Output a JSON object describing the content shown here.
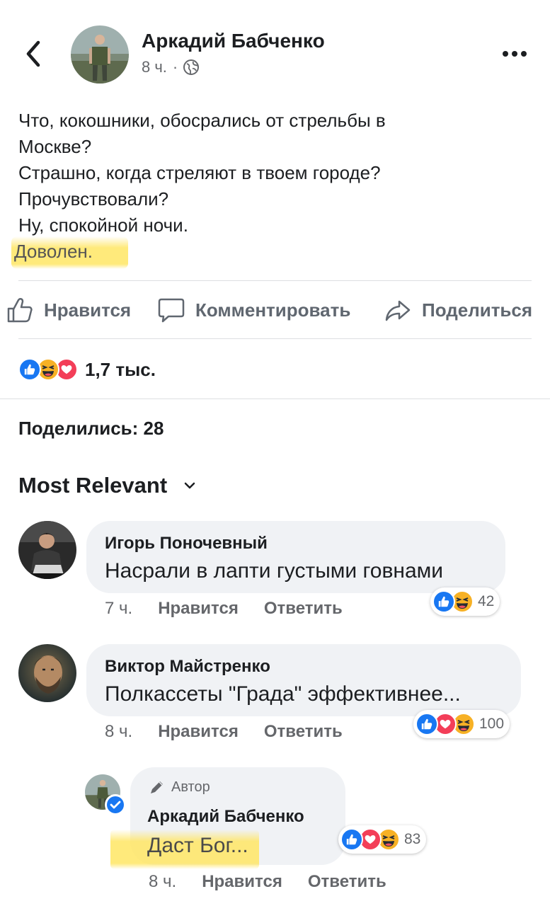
{
  "header": {
    "author_name": "Аркадий Бабченко",
    "time": "8 ч.",
    "separator": "·",
    "privacy_icon": "globe-icon",
    "back_icon": "chevron-left-icon",
    "more_icon": "more-horizontal-icon"
  },
  "post": {
    "lines": [
      "Что, кокошники, обосрались от стрельбы в",
      "Москве?",
      "Страшно, когда стреляют в твоем городе?",
      "Прочувствовали?",
      "Ну, спокойной ночи."
    ],
    "highlighted_line": "Доволен."
  },
  "actions": {
    "like": "Нравится",
    "comment": "Комментировать",
    "share": "Поделиться"
  },
  "reactions": {
    "icons": [
      "like-icon",
      "haha-icon",
      "love-icon"
    ],
    "count": "1,7 тыс."
  },
  "shares_text": "Поделились: 28",
  "sort": {
    "label": "Most Relevant",
    "icon": "chevron-down-icon"
  },
  "comments": [
    {
      "name": "Игорь Поночевный",
      "text": "Насрали в лапти густыми говнами",
      "time": "7 ч.",
      "like": "Нравится",
      "reply": "Ответить",
      "reactions": [
        "like-icon",
        "haha-icon"
      ],
      "count": "42"
    },
    {
      "name": "Виктор Майстренко",
      "text": "Полкассеты \"Града\" эффективнее...",
      "time": "8 ч.",
      "like": "Нравится",
      "reply": "Ответить",
      "reactions": [
        "like-icon",
        "love-icon",
        "haha-icon"
      ],
      "count": "100"
    }
  ],
  "reply": {
    "badge": "Автор",
    "name": "Аркадий Бабченко",
    "text": "Даст Бог...",
    "time": "8 ч.",
    "like": "Нравится",
    "reply": "Ответить",
    "reactions": [
      "like-icon",
      "love-icon",
      "haha-icon"
    ],
    "count": "83"
  },
  "colors": {
    "like_blue": "#1877f2",
    "love_red": "#f33e58",
    "haha_yellow": "#f7b125",
    "highlight": "#ffe66a",
    "muted": "#65676b"
  }
}
